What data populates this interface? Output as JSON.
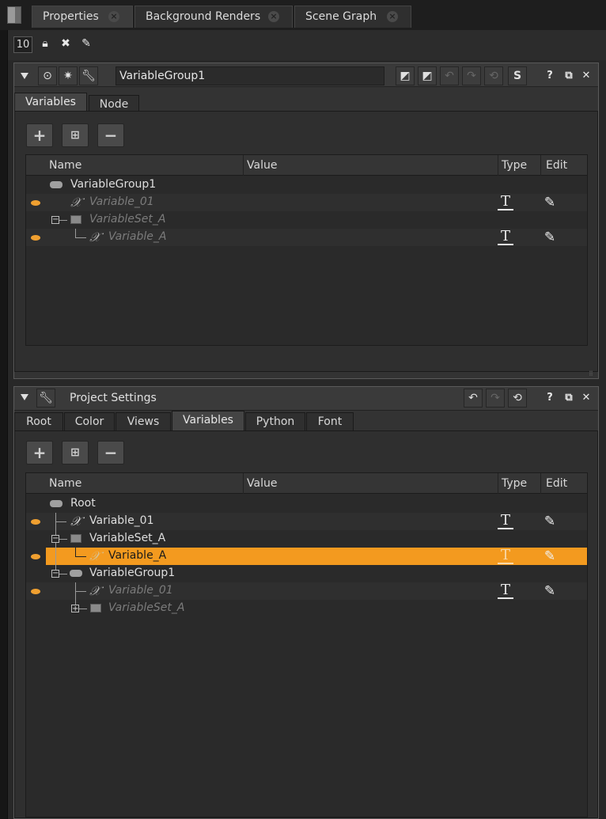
{
  "window": {
    "tabs": [
      {
        "label": "Properties",
        "active": true
      },
      {
        "label": "Background Renders",
        "active": false
      },
      {
        "label": "Scene Graph",
        "active": false
      }
    ]
  },
  "toolbar": {
    "node_count": "10",
    "icons": [
      "lock-icon",
      "clear-panel-icon",
      "edit-pencil-icon"
    ]
  },
  "node_panel": {
    "name": "VariableGroup1",
    "header_buttons": [
      "S",
      "?"
    ],
    "tabs": [
      {
        "label": "Variables",
        "active": true
      },
      {
        "label": "Node",
        "active": false
      }
    ],
    "columns": {
      "name": "Name",
      "value": "Value",
      "type": "Type",
      "edit": "Edit"
    },
    "rows": [
      {
        "label": "VariableGroup1",
        "kind": "group"
      },
      {
        "label": "Variable_01",
        "kind": "variable"
      },
      {
        "label": "VariableSet_A",
        "kind": "set"
      },
      {
        "label": "Variable_A",
        "kind": "variable"
      }
    ]
  },
  "project_panel": {
    "title": "Project Settings",
    "tabs": [
      {
        "label": "Root",
        "active": false
      },
      {
        "label": "Color",
        "active": false
      },
      {
        "label": "Views",
        "active": false
      },
      {
        "label": "Variables",
        "active": true
      },
      {
        "label": "Python",
        "active": false
      },
      {
        "label": "Font",
        "active": false
      }
    ],
    "columns": {
      "name": "Name",
      "value": "Value",
      "type": "Type",
      "edit": "Edit"
    },
    "rows": [
      {
        "label": "Root",
        "kind": "group"
      },
      {
        "label": "Variable_01",
        "kind": "variable"
      },
      {
        "label": "VariableSet_A",
        "kind": "set"
      },
      {
        "label": "Variable_A",
        "kind": "variable",
        "selected": true
      },
      {
        "label": "VariableGroup1",
        "kind": "group"
      },
      {
        "label": "Variable_01",
        "kind": "variable"
      },
      {
        "label": "VariableSet_A",
        "kind": "set"
      }
    ]
  },
  "buttons": {
    "add": "+",
    "remove": "−"
  },
  "colors": {
    "selection": "#f39a1f",
    "visible_eye": "#f0a030",
    "background": "#282828"
  }
}
